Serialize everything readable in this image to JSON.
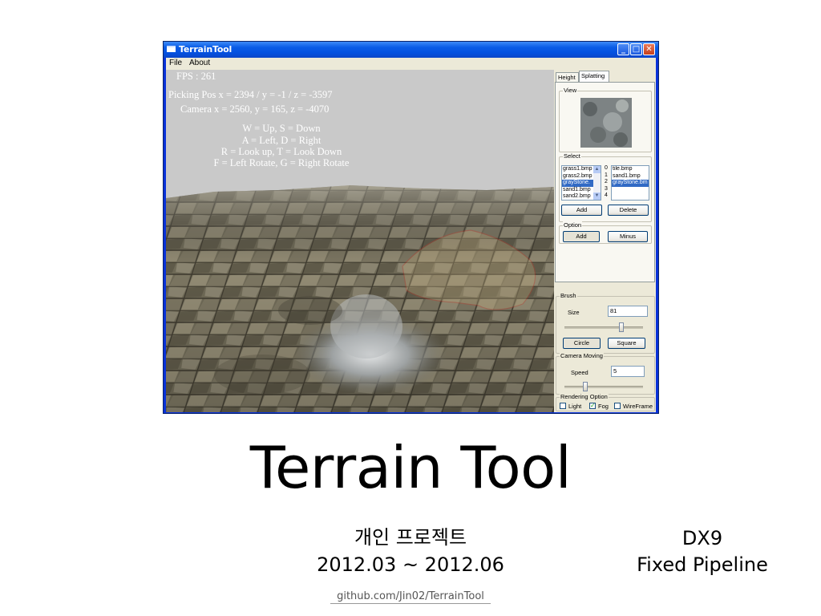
{
  "window": {
    "title": "TerrainTool",
    "menu": [
      "File",
      "About"
    ],
    "buttons": {
      "minimize": "_",
      "maximize": "□",
      "close": "✕"
    }
  },
  "viewport": {
    "fps": "FPS : 261",
    "picking": "Picking Pos x = 2394 / y = -1 / z = -3597",
    "camera": "Camera x = 2560, y = 165, z = -4070",
    "help": [
      "W = Up, S = Down",
      "A = Left, D = Right",
      "R = Look up, T = Look Down",
      "F = Left Rotate, G = Right Rotate"
    ]
  },
  "panel": {
    "tabs": [
      "Height",
      "Splatting"
    ],
    "active_tab": "Splatting",
    "view_label": "View",
    "select_label": "Select",
    "textures": [
      "grass1.bmp",
      "grass2.bmp",
      "grayStone.",
      "sand1.bmp",
      "sand2.bmp"
    ],
    "texture_selected_index": 2,
    "layer_indices": [
      "0",
      "1",
      "2",
      "3",
      "4"
    ],
    "layers": [
      "tile.bmp",
      "sand1.bmp",
      "grayStone.bm"
    ],
    "layer_selected_index": 2,
    "add_button": "Add",
    "delete_button": "Delete",
    "option_label": "Option",
    "option_add": "Add",
    "option_minus": "Minus",
    "brush_label": "Brush",
    "size_label": "Size",
    "size_value": "81",
    "size_slider_fraction": 0.72,
    "circle_button": "Circle",
    "square_button": "Square",
    "camera_moving_label": "Camera Moving",
    "speed_label": "Speed",
    "speed_value": "5",
    "speed_slider_fraction": 0.27,
    "rendering_label": "Rendering Option",
    "light_label": "Light",
    "light_checked": false,
    "fog_label": "Fog",
    "fog_checked": true,
    "wireframe_label": "WireFrame",
    "wireframe_checked": false
  },
  "slide": {
    "title": "Terrain Tool",
    "subtitle": "개인 프로젝트",
    "dates": "2012.03 ~ 2012.06",
    "tech1": "DX9",
    "tech2": "Fixed Pipeline",
    "link": "github.com/Jin02/TerrainTool"
  }
}
